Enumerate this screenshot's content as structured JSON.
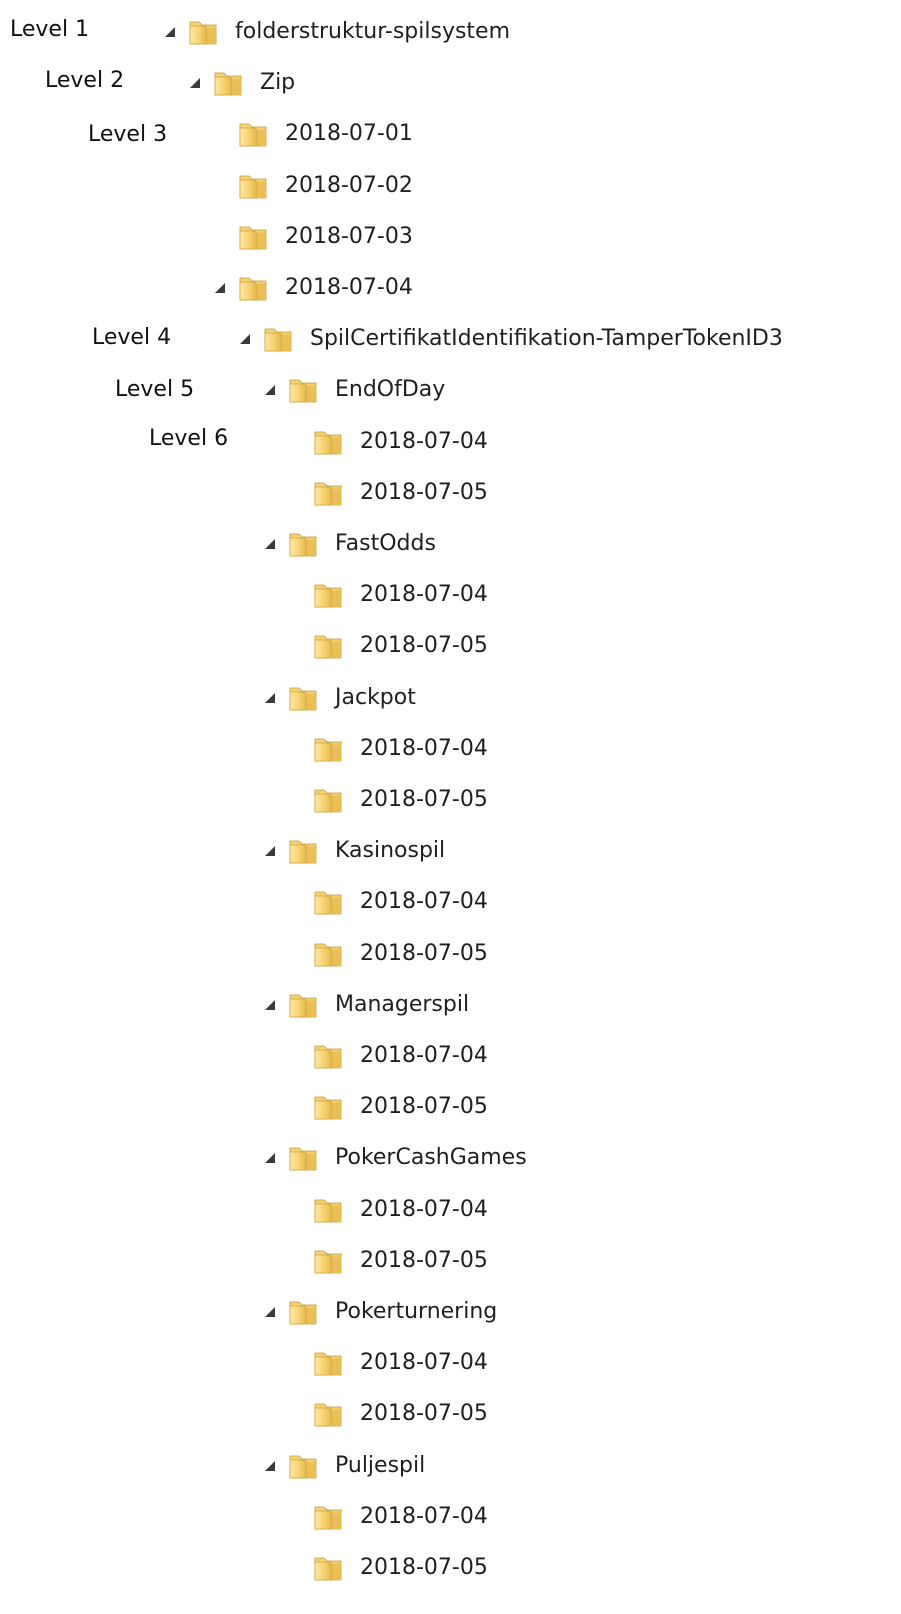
{
  "annotations": {
    "levels": [
      "Level 1",
      "Level 2",
      "Level 3",
      "Level 4",
      "Level 5",
      "Level 6"
    ]
  },
  "tree": [
    {
      "label": "folderstruktur-spilsystem",
      "level": 1,
      "expanded": true,
      "icon": "folder-icon"
    },
    {
      "label": "Zip",
      "level": 2,
      "expanded": true,
      "icon": "folder-icon"
    },
    {
      "label": "2018-07-01",
      "level": 3,
      "expanded": false,
      "icon": "folder-icon"
    },
    {
      "label": "2018-07-02",
      "level": 3,
      "expanded": false,
      "icon": "folder-icon"
    },
    {
      "label": "2018-07-03",
      "level": 3,
      "expanded": false,
      "icon": "folder-icon"
    },
    {
      "label": "2018-07-04",
      "level": 3,
      "expanded": true,
      "icon": "folder-icon"
    },
    {
      "label": "SpilCertifikatIdentifikation-TamperTokenID3",
      "level": 4,
      "expanded": true,
      "icon": "folder-icon"
    },
    {
      "label": "EndOfDay",
      "level": 5,
      "expanded": true,
      "icon": "folder-icon"
    },
    {
      "label": "2018-07-04",
      "level": 6,
      "expanded": false,
      "icon": "folder-icon"
    },
    {
      "label": "2018-07-05",
      "level": 6,
      "expanded": false,
      "icon": "folder-icon"
    },
    {
      "label": "FastOdds",
      "level": 5,
      "expanded": true,
      "icon": "folder-icon"
    },
    {
      "label": "2018-07-04",
      "level": 6,
      "expanded": false,
      "icon": "folder-icon"
    },
    {
      "label": "2018-07-05",
      "level": 6,
      "expanded": false,
      "icon": "folder-icon"
    },
    {
      "label": "Jackpot",
      "level": 5,
      "expanded": true,
      "icon": "folder-icon"
    },
    {
      "label": "2018-07-04",
      "level": 6,
      "expanded": false,
      "icon": "folder-icon"
    },
    {
      "label": "2018-07-05",
      "level": 6,
      "expanded": false,
      "icon": "folder-icon"
    },
    {
      "label": "Kasinospil",
      "level": 5,
      "expanded": true,
      "icon": "folder-icon"
    },
    {
      "label": "2018-07-04",
      "level": 6,
      "expanded": false,
      "icon": "folder-icon"
    },
    {
      "label": "2018-07-05",
      "level": 6,
      "expanded": false,
      "icon": "folder-icon"
    },
    {
      "label": "Managerspil",
      "level": 5,
      "expanded": true,
      "icon": "folder-icon"
    },
    {
      "label": "2018-07-04",
      "level": 6,
      "expanded": false,
      "icon": "folder-icon"
    },
    {
      "label": "2018-07-05",
      "level": 6,
      "expanded": false,
      "icon": "folder-icon"
    },
    {
      "label": "PokerCashGames",
      "level": 5,
      "expanded": true,
      "icon": "folder-icon"
    },
    {
      "label": "2018-07-04",
      "level": 6,
      "expanded": false,
      "icon": "folder-icon"
    },
    {
      "label": "2018-07-05",
      "level": 6,
      "expanded": false,
      "icon": "folder-icon"
    },
    {
      "label": "Pokerturnering",
      "level": 5,
      "expanded": true,
      "icon": "folder-icon"
    },
    {
      "label": "2018-07-04",
      "level": 6,
      "expanded": false,
      "icon": "folder-icon"
    },
    {
      "label": "2018-07-05",
      "level": 6,
      "expanded": false,
      "icon": "folder-icon"
    },
    {
      "label": "Puljespil",
      "level": 5,
      "expanded": true,
      "icon": "folder-icon"
    },
    {
      "label": "2018-07-04",
      "level": 6,
      "expanded": false,
      "icon": "folder-icon"
    },
    {
      "label": "2018-07-05",
      "level": 6,
      "expanded": false,
      "icon": "folder-icon"
    }
  ]
}
